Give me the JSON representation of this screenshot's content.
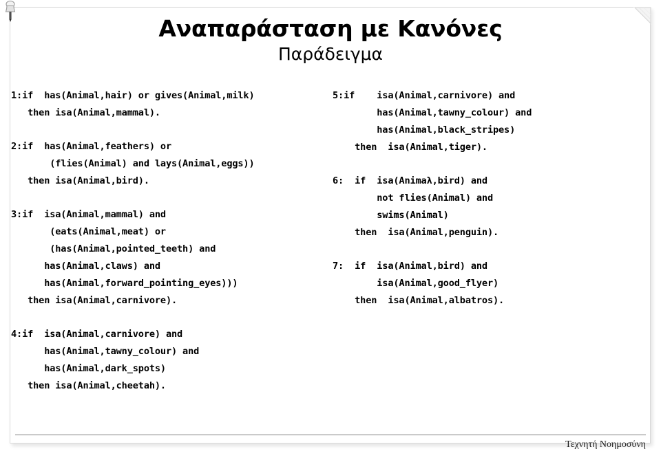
{
  "slide": {
    "title": "Αναπαράσταση με Κανόνες",
    "subtitle": "Παράδειγμα",
    "footer": "Τεχνητή Νοημοσύνη",
    "icons": {
      "pushpin": "pushpin-icon",
      "page_curl": "page-curl-icon"
    },
    "colors": {
      "background": "#ffffff",
      "text": "#000000",
      "frame_border": "#d9d9d9",
      "footer_rule": "#808080"
    }
  },
  "rules": {
    "left_column": [
      {
        "id": "rule-1",
        "lines": [
          "1:if  has(Animal,hair) or gives(Animal,milk)",
          "   then isa(Animal,mammal)."
        ]
      },
      {
        "id": "rule-2",
        "lines": [
          "2:if  has(Animal,feathers) or",
          "       (flies(Animal) and lays(Animal,eggs))",
          "   then isa(Animal,bird)."
        ]
      },
      {
        "id": "rule-3",
        "lines": [
          "3:if  isa(Animal,mammal) and",
          "       (eats(Animal,meat) or",
          "       (has(Animal,pointed_teeth) and",
          "      has(Animal,claws) and",
          "      has(Animal,forward_pointing_eyes)))",
          "   then isa(Animal,carnivore)."
        ]
      },
      {
        "id": "rule-4",
        "lines": [
          "4:if  isa(Animal,carnivore) and",
          "      has(Animal,tawny_colour) and",
          "      has(Animal,dark_spots)",
          "   then isa(Animal,cheetah)."
        ]
      }
    ],
    "right_column": [
      {
        "id": "rule-5",
        "lines": [
          "5:if    isa(Animal,carnivore) and",
          "        has(Animal,tawny_colour) and",
          "        has(Animal,black_stripes)",
          "    then  isa(Animal,tiger)."
        ]
      },
      {
        "id": "rule-6",
        "lines": [
          "6:  if  isa(Animaλ,bird) and",
          "        not flies(Animal) and",
          "        swims(Animal)",
          "    then  isa(Animal,penguin)."
        ]
      },
      {
        "id": "rule-7",
        "lines": [
          "7:  if  isa(Animal,bird) and",
          "        isa(Animal,good_flyer)",
          "    then  isa(Animal,albatros)."
        ]
      }
    ]
  }
}
